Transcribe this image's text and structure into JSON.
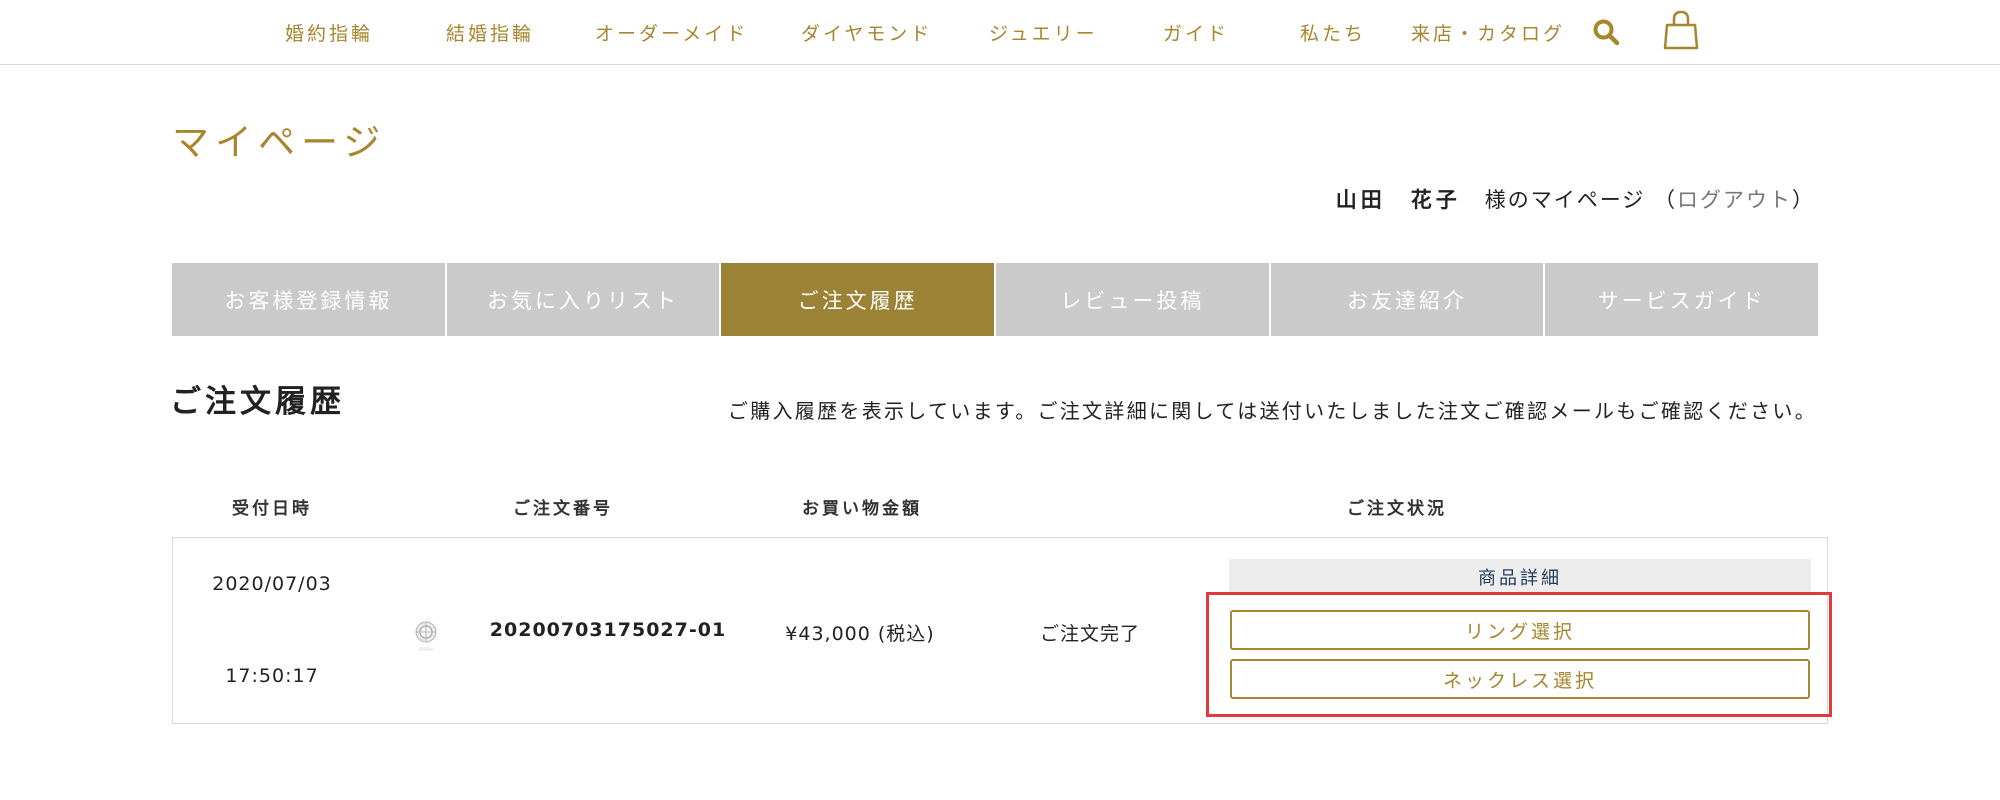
{
  "nav": {
    "items": [
      "婚約指輪",
      "結婚指輪",
      "オーダーメイド",
      "ダイヤモンド",
      "ジュエリー",
      "ガイド",
      "私たち",
      "来店・カタログ"
    ],
    "icons": [
      "search-icon",
      "shopping-bag-icon"
    ]
  },
  "page_title": "マイページ",
  "user": {
    "name": "山田　花子",
    "suffix": "様のマイページ",
    "logout_open": "（",
    "logout": "ログアウト",
    "logout_close": "）"
  },
  "tabs": [
    "お客様登録情報",
    "お気に入りリスト",
    "ご注文履歴",
    "レビュー投稿",
    "お友達紹介",
    "サービスガイド"
  ],
  "active_tab": "ご注文履歴",
  "section": {
    "title": "ご注文履歴",
    "description": "ご購入履歴を表示しています。ご注文詳細に関しては送付いたしました注文ご確認メールもご確認ください。"
  },
  "table": {
    "headers": [
      "受付日時",
      "ご注文番号",
      "お買い物金額",
      "ご注文状況"
    ],
    "order": {
      "date": "2020/07/03",
      "time": "17:50:17",
      "order_number": "20200703175027-01",
      "amount": "¥43,000 (税込)",
      "status": "ご注文完了",
      "detail_label": "商品詳細",
      "buttons": [
        "リング選択",
        "ネックレス選択"
      ]
    }
  },
  "colors": {
    "gold": "#a7862e",
    "active_tab": "#9c8235",
    "inactive_tab": "#cacaca",
    "highlight": "#e03a3f"
  }
}
